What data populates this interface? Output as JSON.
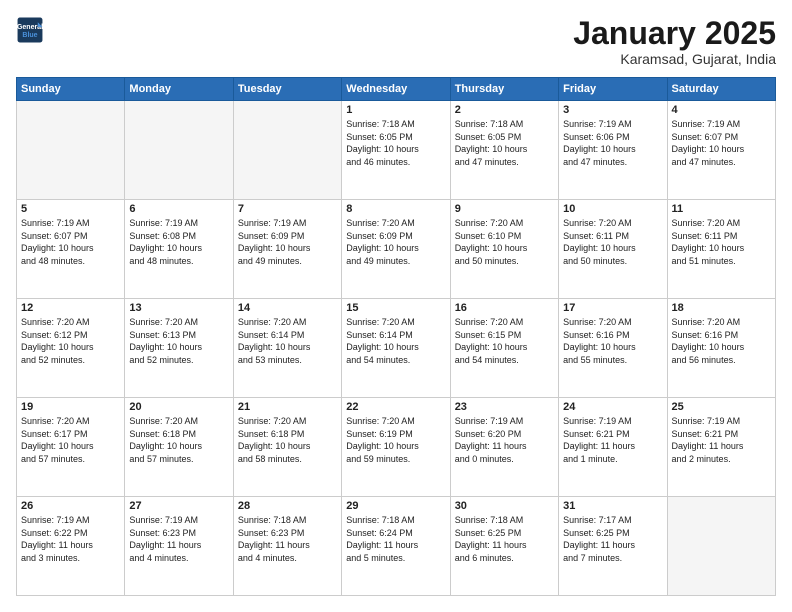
{
  "header": {
    "logo_line1": "General",
    "logo_line2": "Blue",
    "month_title": "January 2025",
    "location": "Karamsad, Gujarat, India"
  },
  "days_of_week": [
    "Sunday",
    "Monday",
    "Tuesday",
    "Wednesday",
    "Thursday",
    "Friday",
    "Saturday"
  ],
  "weeks": [
    [
      {
        "day": "",
        "info": ""
      },
      {
        "day": "",
        "info": ""
      },
      {
        "day": "",
        "info": ""
      },
      {
        "day": "1",
        "info": "Sunrise: 7:18 AM\nSunset: 6:05 PM\nDaylight: 10 hours\nand 46 minutes."
      },
      {
        "day": "2",
        "info": "Sunrise: 7:18 AM\nSunset: 6:05 PM\nDaylight: 10 hours\nand 47 minutes."
      },
      {
        "day": "3",
        "info": "Sunrise: 7:19 AM\nSunset: 6:06 PM\nDaylight: 10 hours\nand 47 minutes."
      },
      {
        "day": "4",
        "info": "Sunrise: 7:19 AM\nSunset: 6:07 PM\nDaylight: 10 hours\nand 47 minutes."
      }
    ],
    [
      {
        "day": "5",
        "info": "Sunrise: 7:19 AM\nSunset: 6:07 PM\nDaylight: 10 hours\nand 48 minutes."
      },
      {
        "day": "6",
        "info": "Sunrise: 7:19 AM\nSunset: 6:08 PM\nDaylight: 10 hours\nand 48 minutes."
      },
      {
        "day": "7",
        "info": "Sunrise: 7:19 AM\nSunset: 6:09 PM\nDaylight: 10 hours\nand 49 minutes."
      },
      {
        "day": "8",
        "info": "Sunrise: 7:20 AM\nSunset: 6:09 PM\nDaylight: 10 hours\nand 49 minutes."
      },
      {
        "day": "9",
        "info": "Sunrise: 7:20 AM\nSunset: 6:10 PM\nDaylight: 10 hours\nand 50 minutes."
      },
      {
        "day": "10",
        "info": "Sunrise: 7:20 AM\nSunset: 6:11 PM\nDaylight: 10 hours\nand 50 minutes."
      },
      {
        "day": "11",
        "info": "Sunrise: 7:20 AM\nSunset: 6:11 PM\nDaylight: 10 hours\nand 51 minutes."
      }
    ],
    [
      {
        "day": "12",
        "info": "Sunrise: 7:20 AM\nSunset: 6:12 PM\nDaylight: 10 hours\nand 52 minutes."
      },
      {
        "day": "13",
        "info": "Sunrise: 7:20 AM\nSunset: 6:13 PM\nDaylight: 10 hours\nand 52 minutes."
      },
      {
        "day": "14",
        "info": "Sunrise: 7:20 AM\nSunset: 6:14 PM\nDaylight: 10 hours\nand 53 minutes."
      },
      {
        "day": "15",
        "info": "Sunrise: 7:20 AM\nSunset: 6:14 PM\nDaylight: 10 hours\nand 54 minutes."
      },
      {
        "day": "16",
        "info": "Sunrise: 7:20 AM\nSunset: 6:15 PM\nDaylight: 10 hours\nand 54 minutes."
      },
      {
        "day": "17",
        "info": "Sunrise: 7:20 AM\nSunset: 6:16 PM\nDaylight: 10 hours\nand 55 minutes."
      },
      {
        "day": "18",
        "info": "Sunrise: 7:20 AM\nSunset: 6:16 PM\nDaylight: 10 hours\nand 56 minutes."
      }
    ],
    [
      {
        "day": "19",
        "info": "Sunrise: 7:20 AM\nSunset: 6:17 PM\nDaylight: 10 hours\nand 57 minutes."
      },
      {
        "day": "20",
        "info": "Sunrise: 7:20 AM\nSunset: 6:18 PM\nDaylight: 10 hours\nand 57 minutes."
      },
      {
        "day": "21",
        "info": "Sunrise: 7:20 AM\nSunset: 6:18 PM\nDaylight: 10 hours\nand 58 minutes."
      },
      {
        "day": "22",
        "info": "Sunrise: 7:20 AM\nSunset: 6:19 PM\nDaylight: 10 hours\nand 59 minutes."
      },
      {
        "day": "23",
        "info": "Sunrise: 7:19 AM\nSunset: 6:20 PM\nDaylight: 11 hours\nand 0 minutes."
      },
      {
        "day": "24",
        "info": "Sunrise: 7:19 AM\nSunset: 6:21 PM\nDaylight: 11 hours\nand 1 minute."
      },
      {
        "day": "25",
        "info": "Sunrise: 7:19 AM\nSunset: 6:21 PM\nDaylight: 11 hours\nand 2 minutes."
      }
    ],
    [
      {
        "day": "26",
        "info": "Sunrise: 7:19 AM\nSunset: 6:22 PM\nDaylight: 11 hours\nand 3 minutes."
      },
      {
        "day": "27",
        "info": "Sunrise: 7:19 AM\nSunset: 6:23 PM\nDaylight: 11 hours\nand 4 minutes."
      },
      {
        "day": "28",
        "info": "Sunrise: 7:18 AM\nSunset: 6:23 PM\nDaylight: 11 hours\nand 4 minutes."
      },
      {
        "day": "29",
        "info": "Sunrise: 7:18 AM\nSunset: 6:24 PM\nDaylight: 11 hours\nand 5 minutes."
      },
      {
        "day": "30",
        "info": "Sunrise: 7:18 AM\nSunset: 6:25 PM\nDaylight: 11 hours\nand 6 minutes."
      },
      {
        "day": "31",
        "info": "Sunrise: 7:17 AM\nSunset: 6:25 PM\nDaylight: 11 hours\nand 7 minutes."
      },
      {
        "day": "",
        "info": ""
      }
    ]
  ]
}
